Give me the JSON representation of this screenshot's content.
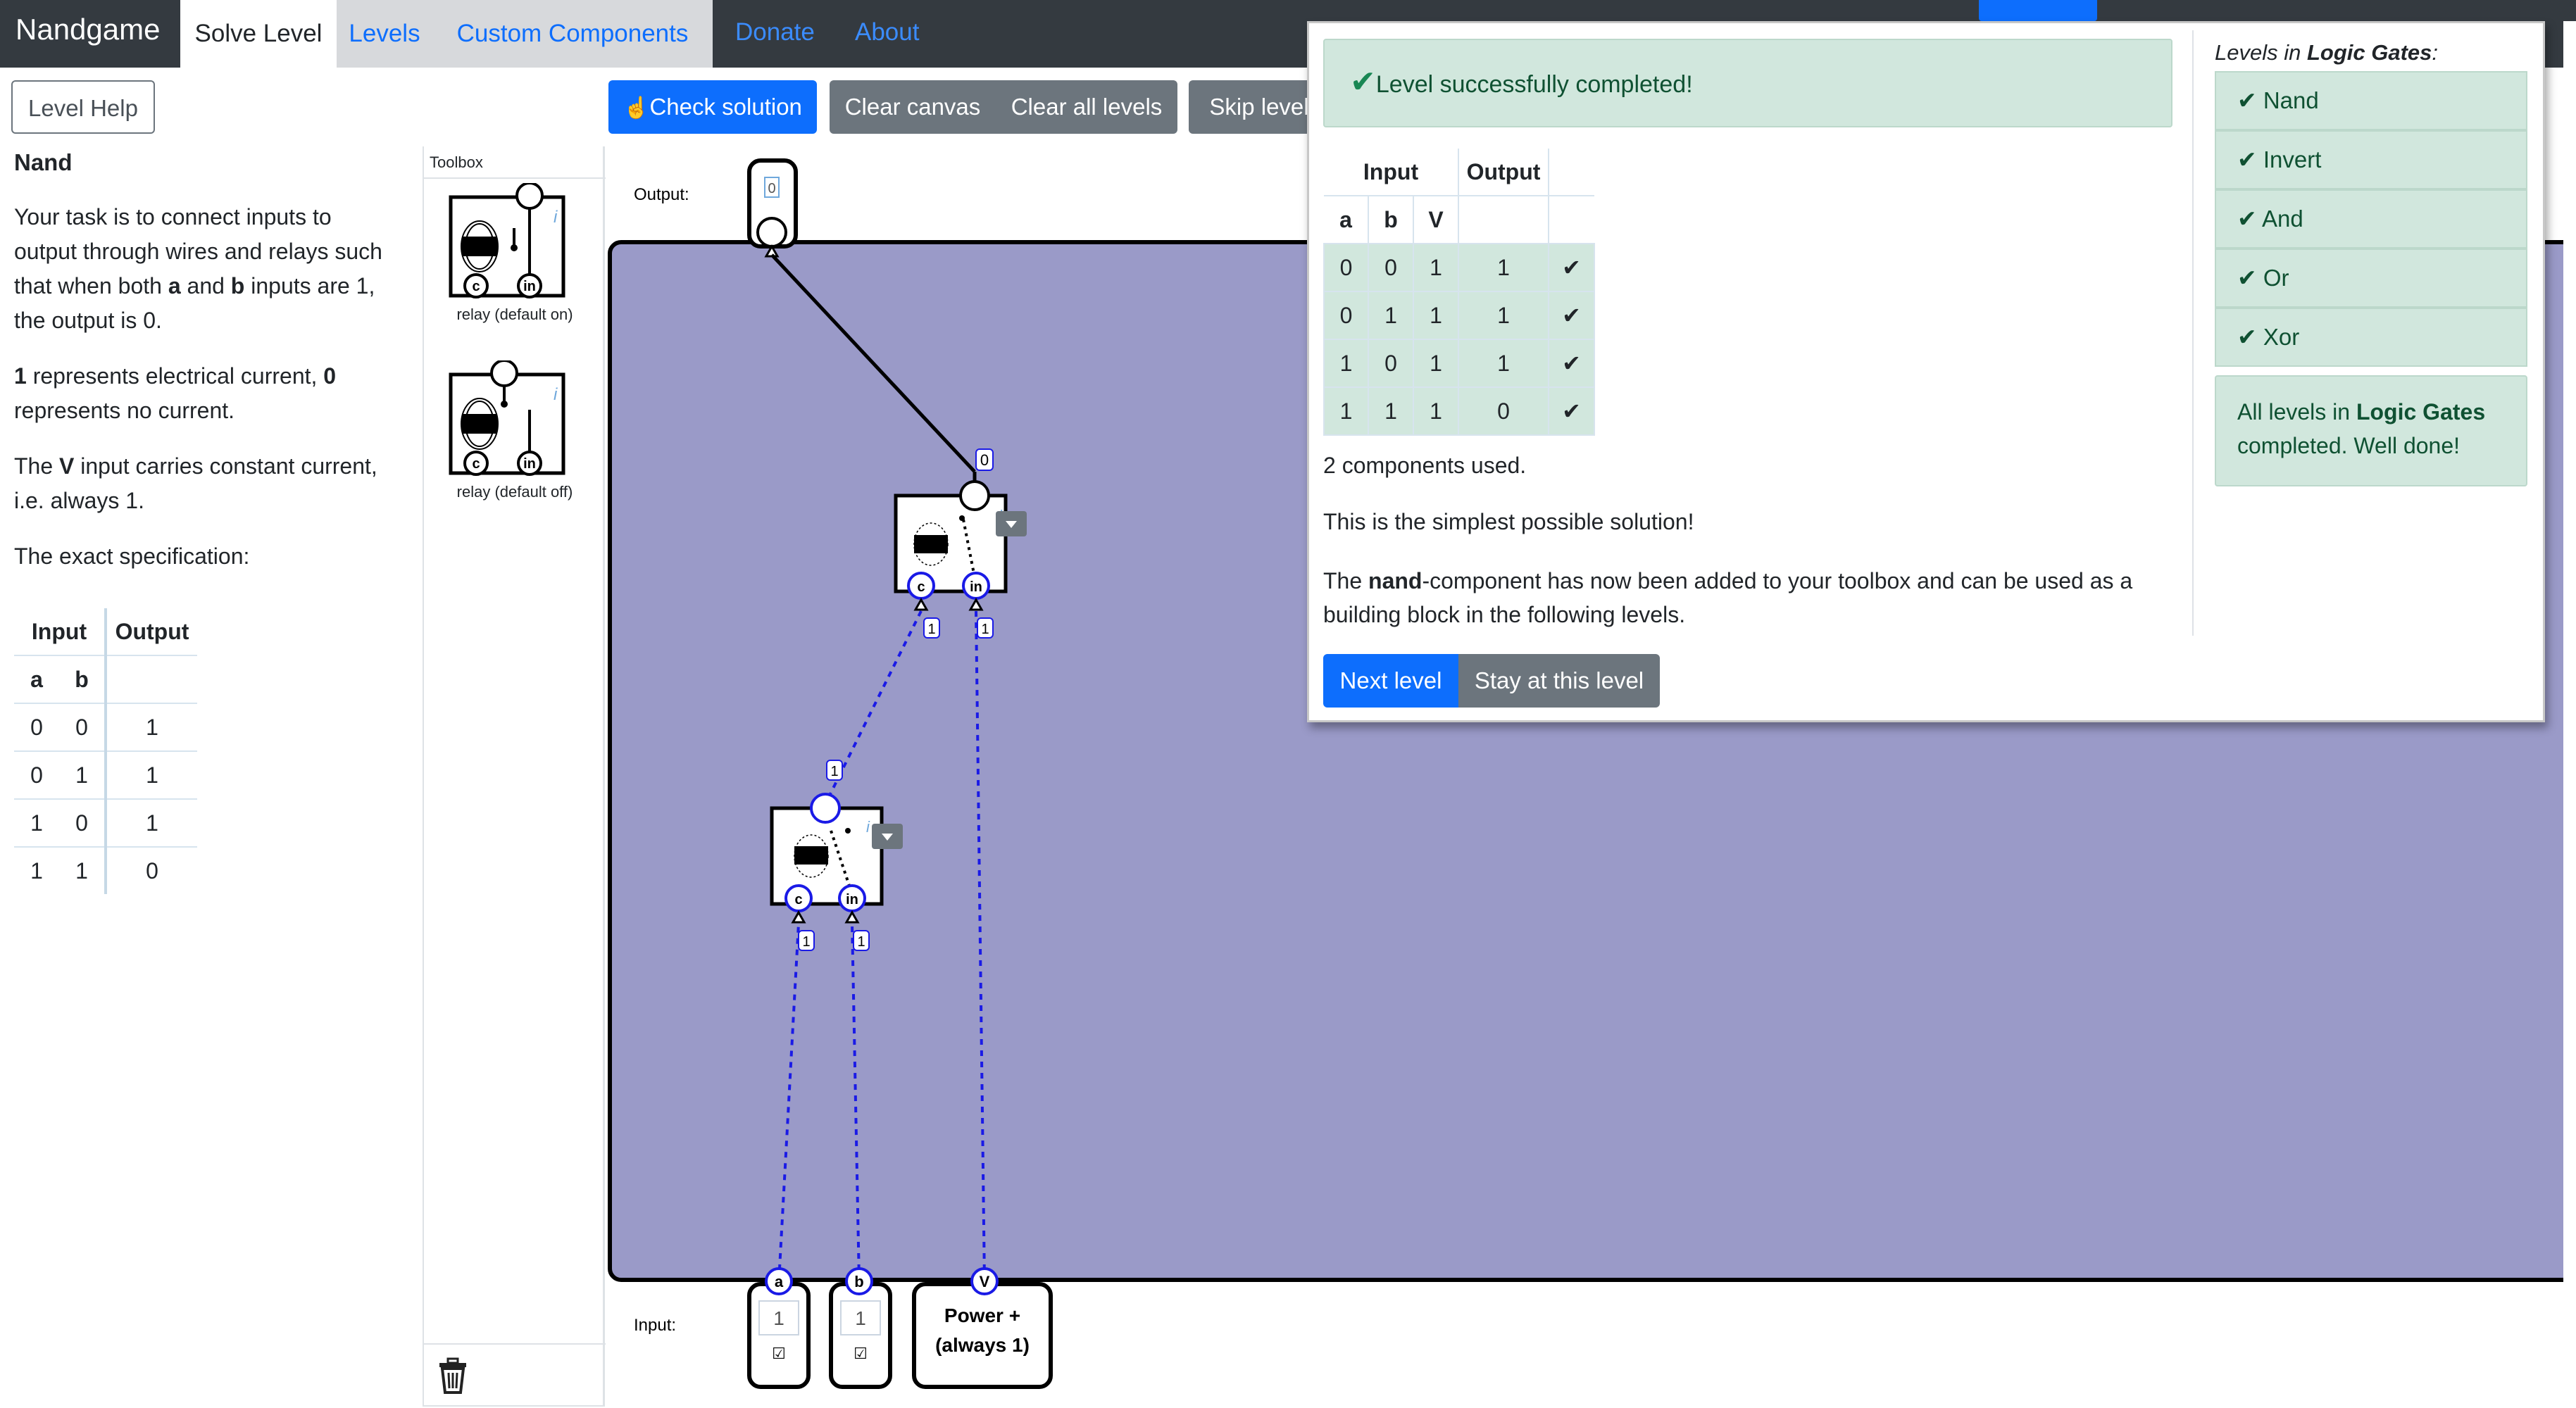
{
  "nav": {
    "brand": "Nandgame",
    "tabs": [
      "Solve Level",
      "Levels",
      "Custom Components"
    ],
    "links": [
      "Donate",
      "About"
    ]
  },
  "toolbar": {
    "level_help": "Level Help",
    "check_solution": "Check solution",
    "clear_canvas": "Clear canvas",
    "clear_all_levels": "Clear all levels",
    "skip_level": "Skip level"
  },
  "left_pane": {
    "title": "Nand",
    "desc_pre": "Your task is to connect inputs to output through wires and relays such that when both",
    "desc_a": "a",
    "desc_and": "and",
    "desc_b": "b",
    "desc_post": "inputs are 1, the output is 0.",
    "current_1": "1",
    "current_mid": "represents electrical current,",
    "current_0": "0",
    "current_post": "represents no current.",
    "v_pre": "The",
    "v_name": "V",
    "v_post": "input carries constant current, i.e. always 1.",
    "spec_label": "The exact specification:",
    "spec_table": {
      "group_headers": [
        "Input",
        "Output"
      ],
      "col_headers": [
        "a",
        "b"
      ],
      "rows": [
        [
          "0",
          "0",
          "1"
        ],
        [
          "0",
          "1",
          "1"
        ],
        [
          "1",
          "0",
          "1"
        ],
        [
          "1",
          "1",
          "0"
        ]
      ]
    }
  },
  "toolbox": {
    "title": "Toolbox",
    "items": [
      "relay (default on)",
      "relay (default off)"
    ]
  },
  "canvas": {
    "output_label": "Output:",
    "input_label": "Input:",
    "output_value": "0",
    "pin_c": "c",
    "pin_in": "in",
    "relay_info": "i",
    "wire_values": [
      "0",
      "1",
      "1",
      "1",
      "1",
      "1"
    ],
    "inputs": [
      {
        "name": "a",
        "value": "1",
        "check": "☑"
      },
      {
        "name": "b",
        "value": "1",
        "check": "☑"
      },
      {
        "name": "V",
        "label_line1": "Power +",
        "label_line2": "(always 1)"
      }
    ]
  },
  "popup": {
    "success": "Level successfully completed!",
    "result_table": {
      "group_headers": [
        "Input",
        "Output"
      ],
      "col_headers": [
        "a",
        "b",
        "V"
      ],
      "rows": [
        [
          "0",
          "0",
          "1",
          "1",
          "✔"
        ],
        [
          "0",
          "1",
          "1",
          "1",
          "✔"
        ],
        [
          "1",
          "0",
          "1",
          "1",
          "✔"
        ],
        [
          "1",
          "1",
          "1",
          "0",
          "✔"
        ]
      ]
    },
    "components_used": "2 components used.",
    "simplest": "This is the simplest possible solution!",
    "added_pre": "The",
    "added_comp": "nand",
    "added_post": "-component has now been added to your toolbox and can be used as a building block in the following levels.",
    "next_level": "Next level",
    "stay": "Stay at this level",
    "levels_title_pre": "Levels in",
    "levels_title_group": "Logic Gates",
    "levels_title_post": ":",
    "levels": [
      "Nand",
      "Invert",
      "And",
      "Or",
      "Xor"
    ],
    "all_done_pre": "All levels in",
    "all_done_group": "Logic Gates",
    "all_done_post": "completed. Well done!"
  },
  "colors": {
    "navbar": "#343a40",
    "canvas": "#9a9ac8",
    "primary": "#0d6efd",
    "secondary": "#6c757d",
    "success_bg": "#d1e7dd",
    "wire_active": "#1a1ae6"
  }
}
